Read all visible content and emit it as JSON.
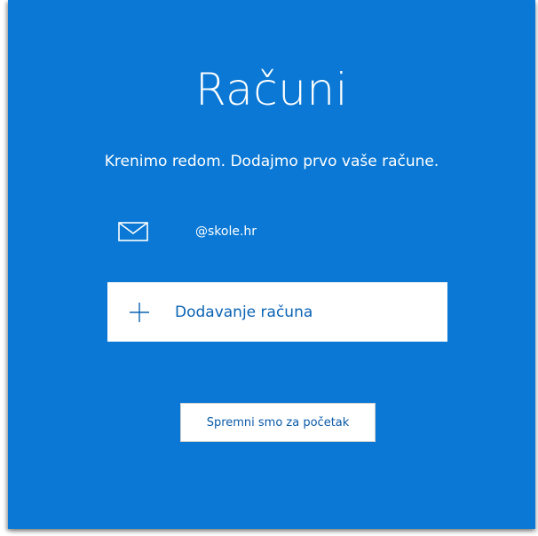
{
  "page": {
    "title": "Računi",
    "subtitle": "Krenimo redom. Dodajmo prvo vaše račune."
  },
  "account": {
    "icon": "mail-icon",
    "email": "@skole.hr"
  },
  "add_account": {
    "icon": "plus-icon",
    "label": "Dodavanje računa"
  },
  "start_button": {
    "label": "Spremni smo za početak"
  },
  "colors": {
    "background": "#0a78d4",
    "accent_text": "#0a63b4",
    "white": "#ffffff"
  }
}
